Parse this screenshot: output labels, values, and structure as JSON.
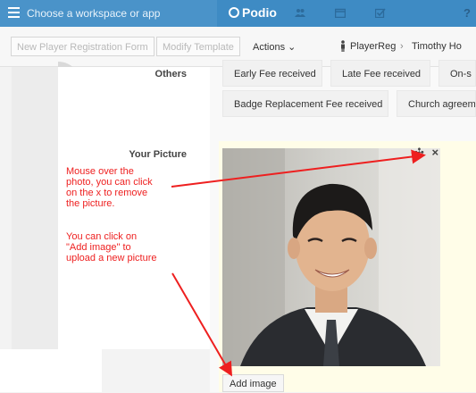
{
  "topbar": {
    "workspace_label": "Choose a workspace or app",
    "brand": "Podio",
    "icons": [
      "menu-icon",
      "contacts-icon",
      "calendar-icon",
      "tasks-icon",
      "help-icon"
    ],
    "help_label": "?"
  },
  "toolbar": {
    "new_form_label": "New Player Registration Form",
    "modify_template_label": "Modify Template",
    "actions_label": "Actions ⌄",
    "breadcrumb": {
      "app": "PlayerReg",
      "separator": "›",
      "item": "Timothy Ho"
    }
  },
  "fields": {
    "others": {
      "label": "Others",
      "chips": [
        "Early Fee received",
        "Late Fee received",
        "On-s",
        "Badge Replacement Fee received",
        "Church agreem"
      ]
    },
    "picture": {
      "label": "Your Picture",
      "tools": {
        "move": "✣",
        "remove": "×"
      },
      "add_image_label": "Add image"
    }
  },
  "annotations": {
    "remove_note": [
      "Mouse over the",
      "photo, you can click",
      "on the x to remove",
      "the picture."
    ],
    "add_note": [
      "You can click on",
      "\"Add image\" to",
      "upload a new picture"
    ]
  },
  "colors": {
    "topbar": "#3e8bc4",
    "annotation": "#ee1f1f",
    "picture_bg": "#fffde8"
  }
}
